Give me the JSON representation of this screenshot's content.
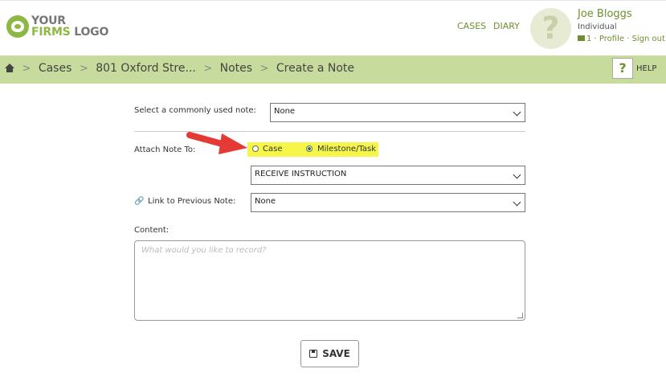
{
  "logo": {
    "line1": "YOUR",
    "line2a": "FIRMS",
    "line2b": " LOGO"
  },
  "top_nav": {
    "cases": "CASES",
    "diary": "DIARY"
  },
  "user": {
    "avatar_glyph": "?",
    "name": "Joe Bloggs",
    "type": "Individual",
    "message_count": "1",
    "links_sep": " · ",
    "profile": "Profile",
    "sign_out": "Sign out"
  },
  "breadcrumb": {
    "items": [
      "Cases",
      "801 Oxford Stre...",
      "Notes",
      "Create a Note"
    ],
    "separator": ">"
  },
  "help": {
    "glyph": "?",
    "label": "HELP"
  },
  "form": {
    "common_note_label": "Select a commonly used note:",
    "common_note_value": "None",
    "attach_label": "Attach Note To:",
    "attach_options": [
      {
        "label": "Case",
        "selected": false
      },
      {
        "label": "Milestone/Task",
        "selected": true
      }
    ],
    "milestone_value": "RECEIVE INSTRUCTION",
    "link_prev_label": "Link to Previous Note:",
    "link_prev_value": "None",
    "content_label": "Content:",
    "content_placeholder": "What would you like to record?",
    "save_label": "SAVE"
  },
  "colors": {
    "brand_green": "#8cb843",
    "link_green": "#6f8f2f",
    "breadcrumb_bg": "#c7dc9c",
    "highlight_yellow": "#f5f54a",
    "arrow_red": "#e53935"
  },
  "icons": [
    "logo-paw-icon",
    "home-icon",
    "envelope-icon",
    "help-icon",
    "link-icon",
    "chevron-down-icon",
    "save-icon",
    "red-arrow-icon"
  ]
}
